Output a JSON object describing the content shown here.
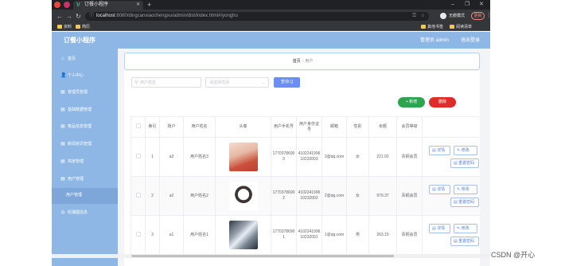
{
  "browser": {
    "tab_title": "订餐小程序",
    "tab_favicon": "V",
    "url_host": "localhost",
    "url_rest": ":8080/dingcanxiaochengxu/admin/dist/index.html#/yonghu",
    "profile_label": "无痕模式",
    "update_label": "更新",
    "bookmarks": [
      "资料",
      "简历"
    ],
    "bookmarks_right": [
      "其他书签",
      "阅读清单"
    ]
  },
  "app": {
    "title": "订餐小程序",
    "admin_label": "管理员 admin",
    "logout_label": "退出登录"
  },
  "sidebar": {
    "items": [
      {
        "label": "首页",
        "icon": "home-icon",
        "glyph": "⌂"
      },
      {
        "label": "个人中心",
        "icon": "user-icon",
        "glyph": "👤"
      },
      {
        "label": "管理员管理",
        "icon": "admin-icon",
        "glyph": "▤"
      },
      {
        "label": "基础数据管理",
        "icon": "data-icon",
        "glyph": "▤"
      },
      {
        "label": "菜品信息管理",
        "icon": "dish-icon",
        "glyph": "▤"
      },
      {
        "label": "新闻资讯管理",
        "icon": "news-icon",
        "glyph": "▤"
      },
      {
        "label": "商家管理",
        "icon": "shop-icon",
        "glyph": "▤"
      },
      {
        "label": "用户管理",
        "icon": "users-icon",
        "glyph": "▤"
      },
      {
        "label": "用户管理",
        "icon": "",
        "glyph": ""
      },
      {
        "label": "轮播图信息",
        "icon": "carousel-icon",
        "glyph": "◎"
      }
    ]
  },
  "breadcrumb": {
    "home": "首页",
    "separator": "/",
    "current": "用户"
  },
  "search": {
    "name_placeholder": "用户姓名",
    "type_placeholder": "请选择性别",
    "search_label": "查询 Q",
    "add_label": "+ 新增",
    "delete_label": "删除"
  },
  "table": {
    "headers": [
      "",
      "索引",
      "账户",
      "用户姓名",
      "头像",
      "用户手机号",
      "用户身份证号",
      "邮箱",
      "性别",
      "余额",
      "会员等级",
      "操作"
    ],
    "rows": [
      {
        "index": "1",
        "account": "a3",
        "name": "用户姓名3",
        "phone": "17703786903",
        "idcard": "410224199610232003",
        "email": "3@qq.com",
        "gender": "女",
        "balance": "221.02",
        "level": "青铜会员"
      },
      {
        "index": "2",
        "account": "a2",
        "name": "用户姓名2",
        "phone": "17703786902",
        "idcard": "410224199610232002",
        "email": "2@qq.com",
        "gender": "女",
        "balance": "979.37",
        "level": "青铜会员"
      },
      {
        "index": "3",
        "account": "a1",
        "name": "用户姓名1",
        "phone": "17703786901",
        "idcard": "410224199610232001",
        "email": "1@qq.com",
        "gender": "男",
        "balance": "263.15",
        "level": "青铜会员"
      }
    ],
    "actions": {
      "detail": "详情",
      "edit": "修改",
      "reset": "重置密码"
    }
  },
  "watermark": "CSDN @开心",
  "colors": {
    "header": "#8eb7e6",
    "primary": "#6a8ef5",
    "add": "#2da44e",
    "delete": "#e02b2b"
  }
}
